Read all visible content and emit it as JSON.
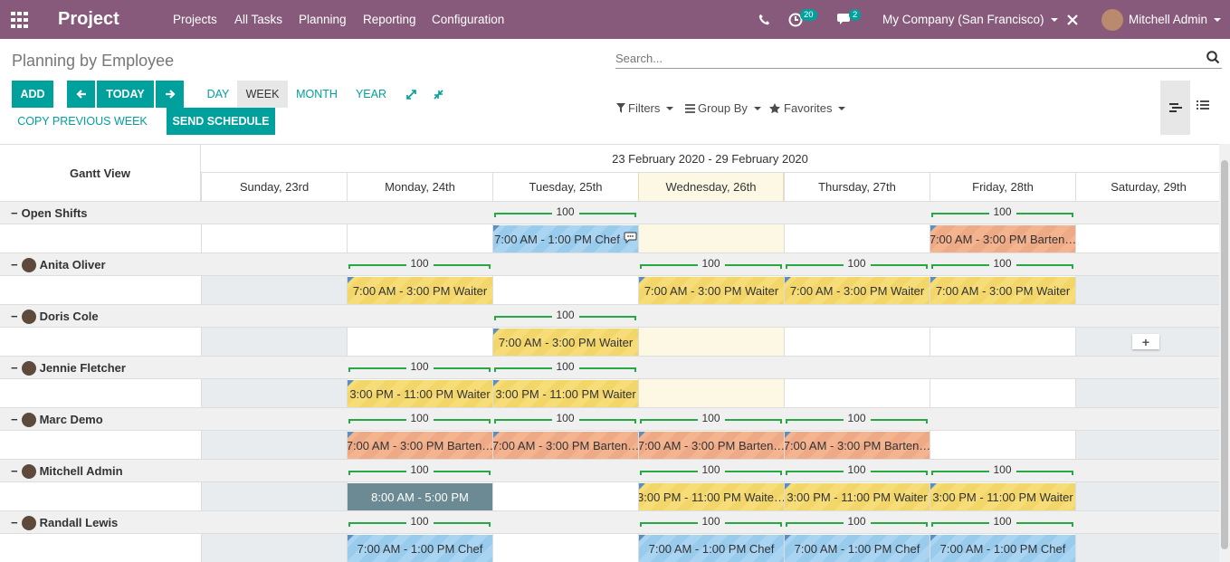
{
  "navbar": {
    "title": "Project",
    "menu": [
      "Projects",
      "All Tasks",
      "Planning",
      "Reporting",
      "Configuration"
    ],
    "activity_count": "20",
    "message_count": "2",
    "company": "My Company (San Francisco)",
    "user": "Mitchell Admin"
  },
  "breadcrumb": "Planning by Employee",
  "search": {
    "placeholder": "Search..."
  },
  "buttons": {
    "add": "ADD",
    "today": "TODAY",
    "copy_prev": "COPY PREVIOUS WEEK",
    "send_schedule": "SEND SCHEDULE",
    "scales": [
      "DAY",
      "WEEK",
      "MONTH",
      "YEAR"
    ],
    "active_scale": "WEEK"
  },
  "filters": {
    "filters": "Filters",
    "group_by": "Group By",
    "favorites": "Favorites"
  },
  "gantt": {
    "title": "Gantt View",
    "range": "23 February 2020 - 29 February 2020",
    "days": [
      "Sunday, 23rd",
      "Monday, 24th",
      "Tuesday, 25th",
      "Wednesday, 26th",
      "Thursday, 27th",
      "Friday, 28th",
      "Saturday, 29th"
    ],
    "today_index": 3,
    "alloc_label": "100",
    "rows": [
      {
        "name": "Open Shifts",
        "avatar": false,
        "unavail": [],
        "pills": [
          {
            "start": 2,
            "span": 1,
            "label": "7:00 AM - 1:00 PM Chef",
            "style": "blue",
            "chat": true
          },
          {
            "start": 5,
            "span": 1,
            "label": "7:00 AM - 3:00 PM Barten…",
            "style": "orange"
          }
        ]
      },
      {
        "name": "Anita Oliver",
        "avatar": true,
        "unavail": [
          0,
          6
        ],
        "pills": [
          {
            "start": 1,
            "span": 1,
            "label": "7:00 AM - 3:00 PM Waiter",
            "style": "yellow"
          },
          {
            "start": 3,
            "span": 1,
            "label": "7:00 AM - 3:00 PM Waiter",
            "style": "yellow"
          },
          {
            "start": 4,
            "span": 1,
            "label": "7:00 AM - 3:00 PM Waiter",
            "style": "yellow"
          },
          {
            "start": 5,
            "span": 1,
            "label": "7:00 AM - 3:00 PM Waiter",
            "style": "yellow"
          }
        ]
      },
      {
        "name": "Doris Cole",
        "avatar": true,
        "unavail": [
          0,
          6
        ],
        "pills": [
          {
            "start": 2,
            "span": 1,
            "label": "7:00 AM - 3:00 PM Waiter",
            "style": "yellow"
          }
        ]
      },
      {
        "name": "Jennie Fletcher",
        "avatar": true,
        "unavail": [
          0,
          6
        ],
        "pills": [
          {
            "start": 1,
            "span": 1,
            "label": "3:00 PM - 11:00 PM Waiter",
            "style": "yellow"
          },
          {
            "start": 2,
            "span": 1,
            "label": "3:00 PM - 11:00 PM Waiter",
            "style": "yellow"
          }
        ]
      },
      {
        "name": "Marc Demo",
        "avatar": true,
        "unavail": [
          0,
          6
        ],
        "pills": [
          {
            "start": 1,
            "span": 1,
            "label": "7:00 AM - 3:00 PM Barten…",
            "style": "orange"
          },
          {
            "start": 2,
            "span": 1,
            "label": "7:00 AM - 3:00 PM Barten…",
            "style": "orange"
          },
          {
            "start": 3,
            "span": 1,
            "label": "7:00 AM - 3:00 PM Barten…",
            "style": "orange"
          },
          {
            "start": 4,
            "span": 1,
            "label": "7:00 AM - 3:00 PM Barten…",
            "style": "orange"
          }
        ]
      },
      {
        "name": "Mitchell Admin",
        "avatar": true,
        "unavail": [
          0,
          6
        ],
        "pills": [
          {
            "start": 1,
            "span": 1,
            "label": "8:00 AM - 5:00 PM",
            "style": "slate"
          },
          {
            "start": 3,
            "span": 1,
            "label": "3:00 PM - 11:00 PM Waite…",
            "style": "yellow"
          },
          {
            "start": 4,
            "span": 1,
            "label": "3:00 PM - 11:00 PM Waiter",
            "style": "yellow"
          },
          {
            "start": 5,
            "span": 1,
            "label": "3:00 PM - 11:00 PM Waiter",
            "style": "yellow"
          }
        ]
      },
      {
        "name": "Randall Lewis",
        "avatar": true,
        "unavail": [
          0,
          6
        ],
        "pills": [
          {
            "start": 1,
            "span": 1,
            "label": "7:00 AM - 1:00 PM Chef",
            "style": "blue"
          },
          {
            "start": 3,
            "span": 1,
            "label": "7:00 AM - 1:00 PM Chef",
            "style": "blue"
          },
          {
            "start": 4,
            "span": 1,
            "label": "7:00 AM - 1:00 PM Chef",
            "style": "blue"
          },
          {
            "start": 5,
            "span": 1,
            "label": "7:00 AM - 1:00 PM Chef",
            "style": "blue"
          }
        ]
      }
    ]
  }
}
